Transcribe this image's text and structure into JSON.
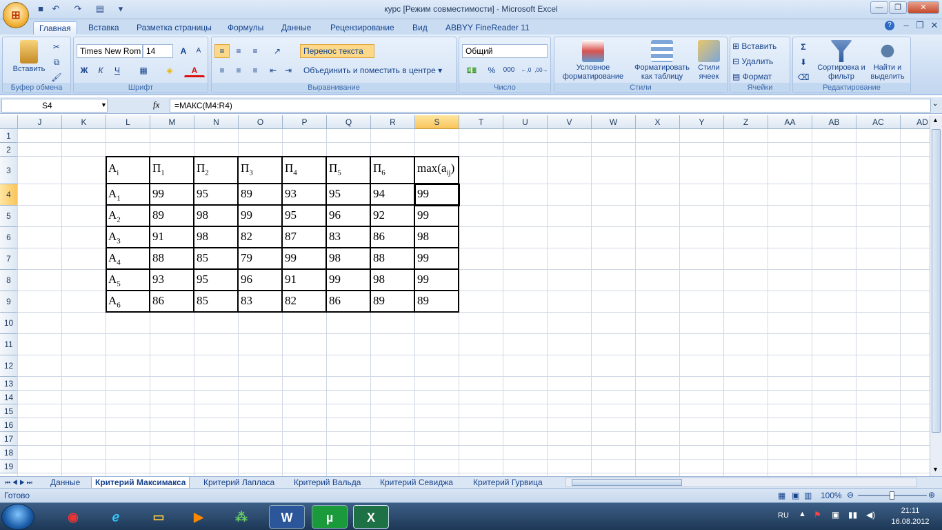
{
  "window": {
    "title": "курс  [Режим совместимости] - Microsoft Excel",
    "office_button": "⊞"
  },
  "ribbon_tabs": [
    "Главная",
    "Вставка",
    "Разметка страницы",
    "Формулы",
    "Данные",
    "Рецензирование",
    "Вид",
    "ABBYY FineReader 11"
  ],
  "ribbon": {
    "clipboard": {
      "label": "Буфер обмена",
      "paste": "Вставить"
    },
    "font": {
      "label": "Шрифт",
      "font_name": "Times New Rom",
      "font_size": "14",
      "bold": "Ж",
      "italic": "К",
      "underline": "Ч",
      "grow": "A",
      "shrink": "A",
      "font_color": "A"
    },
    "alignment": {
      "label": "Выравнивание",
      "wrap": "Перенос текста",
      "merge": "Объединить и поместить в центре"
    },
    "number": {
      "label": "Число",
      "format": "Общий",
      "percent": "%",
      "thousands": "000",
      "inc_dec": ",0​0",
      "dec_dec": ",00"
    },
    "styles": {
      "label": "Стили",
      "conditional": "Условное форматирование",
      "as_table": "Форматировать как таблицу",
      "cell_styles": "Стили ячеек"
    },
    "cells": {
      "label": "Ячейки",
      "insert": "Вставить",
      "delete": "Удалить",
      "format": "Формат"
    },
    "editing": {
      "label": "Редактирование",
      "sum": "Σ",
      "sort": "Сортировка и фильтр",
      "find": "Найти и выделить"
    }
  },
  "formula_bar": {
    "name_box": "S4",
    "fx": "fx",
    "formula": "=МАКС(M4:R4)"
  },
  "columns": [
    "J",
    "K",
    "L",
    "M",
    "N",
    "O",
    "P",
    "Q",
    "R",
    "S",
    "T",
    "U",
    "V",
    "W",
    "X",
    "Y",
    "Z",
    "AA",
    "AB",
    "AC",
    "AD"
  ],
  "rows": [
    "1",
    "2",
    "3",
    "4",
    "5",
    "6",
    "7",
    "8",
    "9",
    "10",
    "11",
    "12",
    "13",
    "14",
    "15",
    "16",
    "17",
    "18",
    "19"
  ],
  "table": {
    "header": [
      {
        "t": "A",
        "s": "i"
      },
      {
        "t": "П",
        "s": "1"
      },
      {
        "t": "П",
        "s": "2"
      },
      {
        "t": "П",
        "s": "3"
      },
      {
        "t": "П",
        "s": "4"
      },
      {
        "t": "П",
        "s": "5"
      },
      {
        "t": "П",
        "s": "6"
      },
      {
        "t": "max(a",
        "s": "ij",
        "e": ")"
      }
    ],
    "rows": [
      {
        "label": "A",
        "sub": "1",
        "values": [
          "99",
          "95",
          "89",
          "93",
          "95",
          "94",
          "99"
        ]
      },
      {
        "label": "A",
        "sub": "2",
        "values": [
          "89",
          "98",
          "99",
          "95",
          "96",
          "92",
          "99"
        ]
      },
      {
        "label": "A",
        "sub": "3",
        "values": [
          "91",
          "98",
          "82",
          "87",
          "83",
          "86",
          "98"
        ]
      },
      {
        "label": "A",
        "sub": "4",
        "values": [
          "88",
          "85",
          "79",
          "99",
          "98",
          "88",
          "99"
        ]
      },
      {
        "label": "A",
        "sub": "5",
        "values": [
          "93",
          "95",
          "96",
          "91",
          "99",
          "98",
          "99"
        ]
      },
      {
        "label": "A",
        "sub": "6",
        "values": [
          "86",
          "85",
          "83",
          "82",
          "86",
          "89",
          "89"
        ]
      }
    ]
  },
  "sheet_tabs": [
    "Данные",
    "Критерий Максимакса",
    "Критерий Лапласа",
    "Критерий Вальда",
    "Критерий Севиджа",
    "Критерий Гурвица"
  ],
  "status": {
    "ready": "Готово",
    "zoom": "100%"
  },
  "taskbar": {
    "lang": "RU",
    "time": "21:11",
    "date": "16.08.2012"
  }
}
